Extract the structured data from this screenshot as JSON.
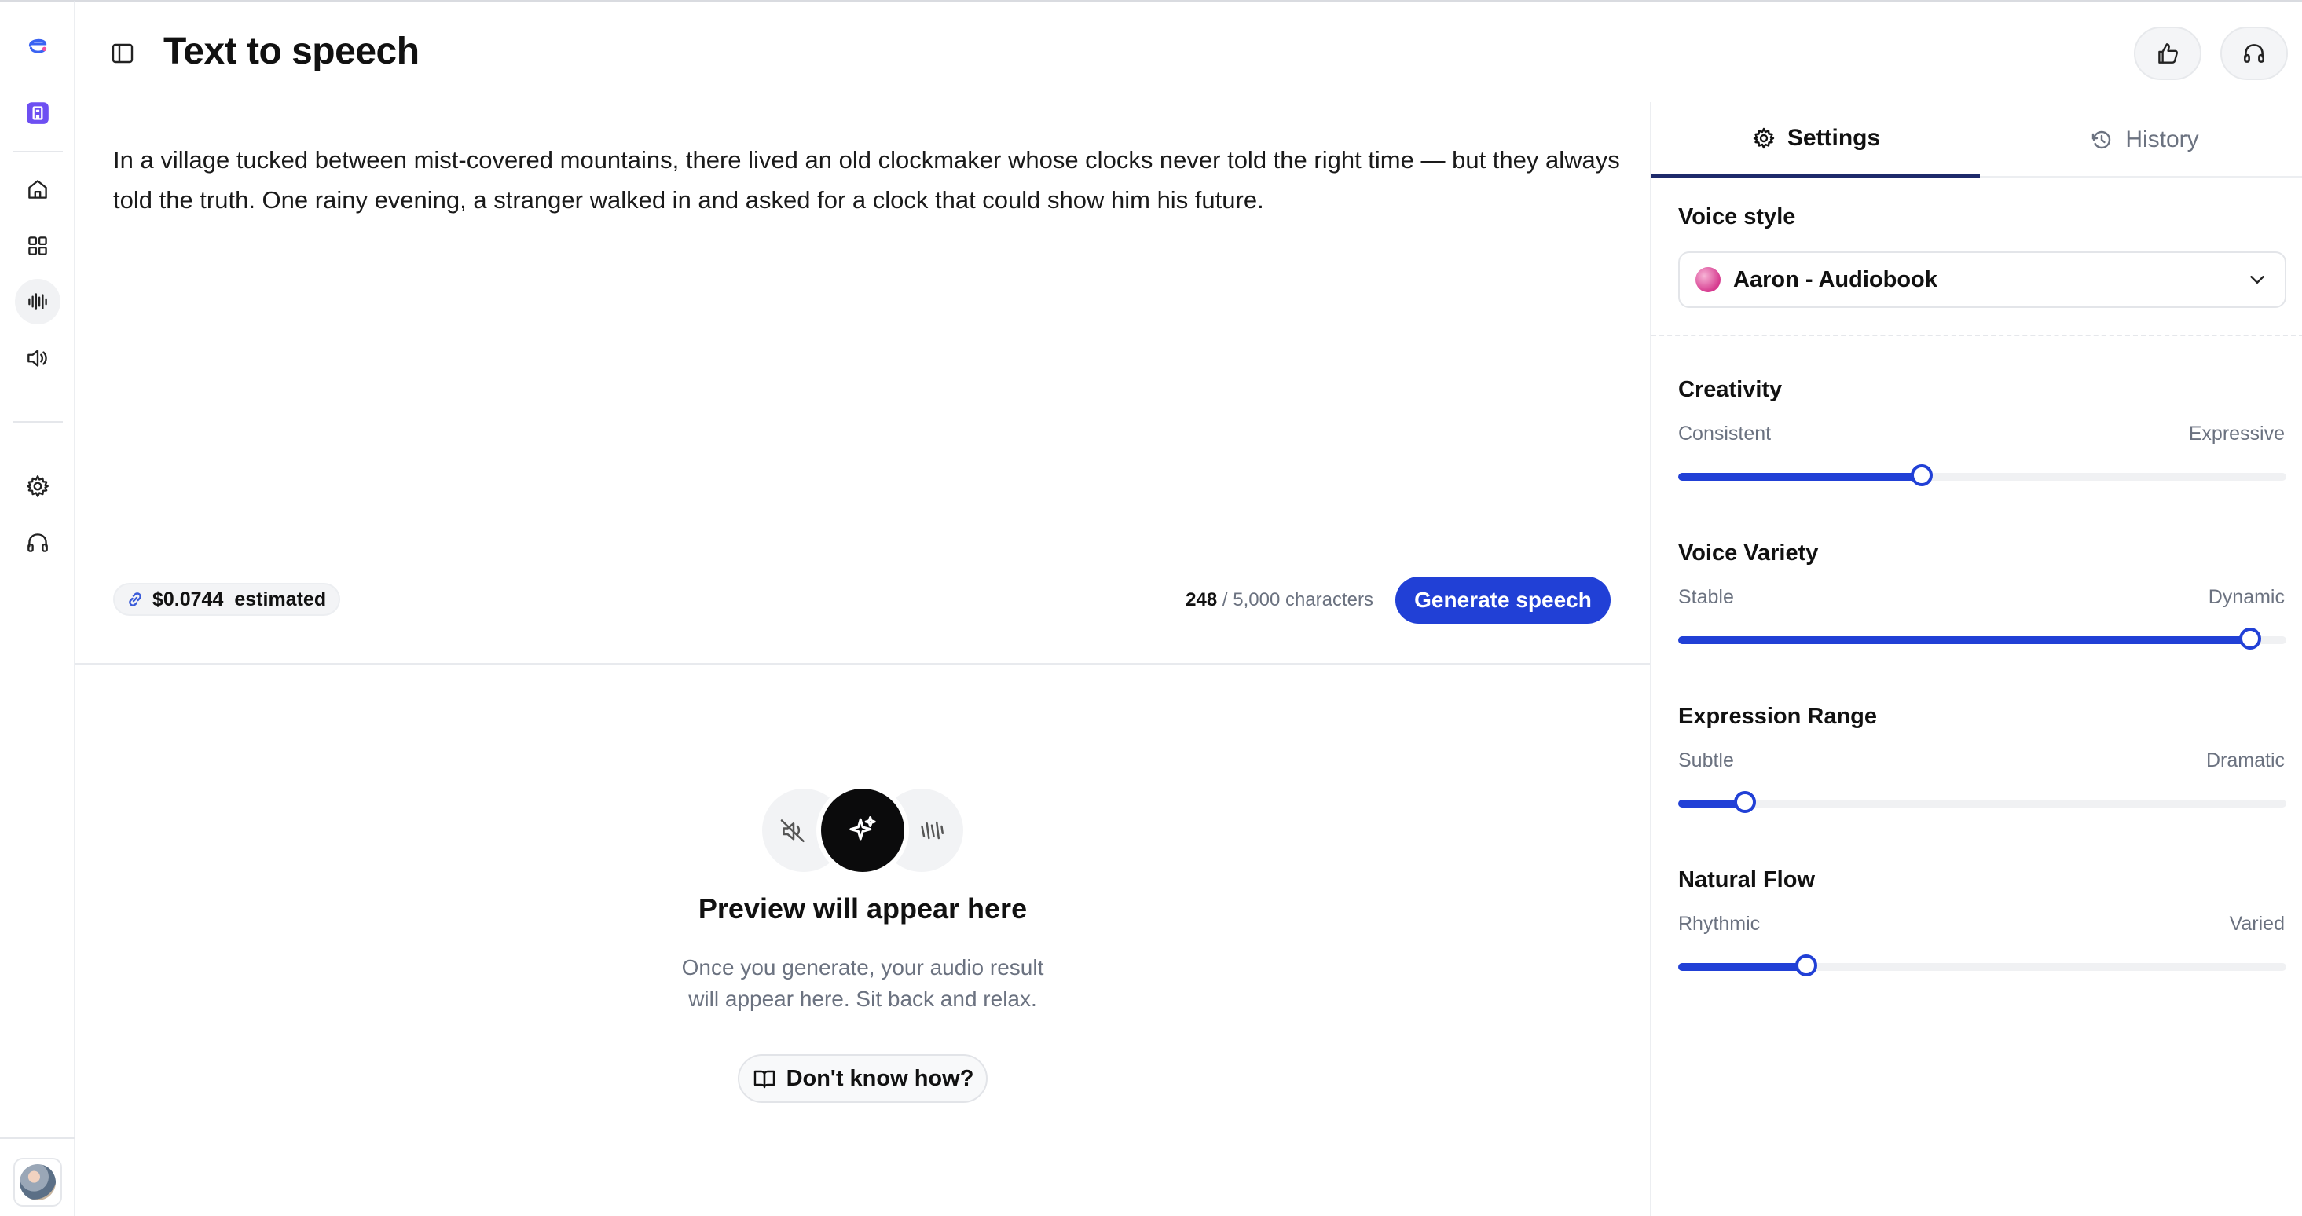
{
  "rail": {
    "items": [
      {
        "name": "logo",
        "icon": "brand-logo-icon"
      },
      {
        "name": "workspace",
        "icon": "workspace-badge-icon"
      },
      {
        "name": "home",
        "icon": "home-icon"
      },
      {
        "name": "apps",
        "icon": "grid-icon"
      },
      {
        "name": "voice",
        "icon": "waveform-icon",
        "active": true
      },
      {
        "name": "sound",
        "icon": "speaker-icon"
      },
      {
        "name": "settings",
        "icon": "gear-icon"
      },
      {
        "name": "support",
        "icon": "headphones-icon"
      }
    ]
  },
  "header": {
    "title": "Text to speech"
  },
  "editor": {
    "text": "In a village tucked between mist-covered mountains, there lived an old clockmaker whose clocks never told the right time — but they always told the truth. One rainy evening, a stranger walked in and asked for a clock that could show him his future.",
    "cost": "$0.0744",
    "cost_suffix": "estimated",
    "char_current": "248",
    "char_limit": "/ 5,000 characters",
    "generate_label": "Generate speech"
  },
  "preview": {
    "title": "Preview will appear here",
    "subtitle_line1": "Once you generate, your audio result",
    "subtitle_line2": "will appear here. Sit back and relax.",
    "help_label": "Don't know how?"
  },
  "panel": {
    "tabs": [
      {
        "label": "Settings",
        "icon": "gear-icon",
        "active": true
      },
      {
        "label": "History",
        "icon": "history-icon",
        "active": false
      }
    ],
    "voice_style_label": "Voice style",
    "voice_selected": "Aaron - Audiobook",
    "sliders": [
      {
        "label": "Creativity",
        "min_label": "Consistent",
        "max_label": "Expressive",
        "value": 0.4
      },
      {
        "label": "Voice Variety",
        "min_label": "Stable",
        "max_label": "Dynamic",
        "value": 0.94
      },
      {
        "label": "Expression Range",
        "min_label": "Subtle",
        "max_label": "Dramatic",
        "value": 0.11
      },
      {
        "label": "Natural Flow",
        "min_label": "Rhythmic",
        "max_label": "Varied",
        "value": 0.21
      }
    ]
  },
  "colors": {
    "accent": "#2140d6",
    "workspace_badge": "#6d4ff2"
  }
}
